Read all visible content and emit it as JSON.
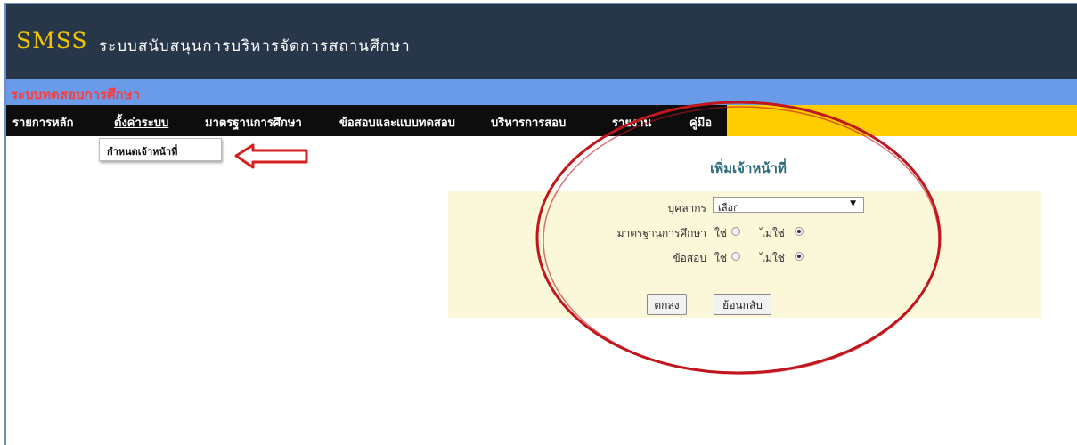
{
  "header": {
    "logo": "SMSS",
    "subtitle": "ระบบสนับสนุนการบริหารจัดการสถานศึกษา",
    "system_name": "ระบบทดสอบการศึกษา"
  },
  "menu": {
    "items": [
      {
        "label": "รายการหลัก"
      },
      {
        "label": "ตั้งค่าระบบ",
        "active": true
      },
      {
        "label": "มาตรฐานการศึกษา"
      },
      {
        "label": "ข้อสอบและแบบทดสอบ"
      },
      {
        "label": "บริหารการสอบ"
      },
      {
        "label": "รายงาน"
      },
      {
        "label": "คู่มือ"
      }
    ],
    "dropdown_item": "กำหนดเจ้าหน้าที่"
  },
  "form": {
    "title": "เพิ่มเจ้าหน้าที่",
    "personnel_label": "บุคลากร",
    "personnel_select": "เลือก",
    "standard_label": "มาตรฐานการศึกษา",
    "exam_label": "ข้อสอบ",
    "yes_label": "ใช่",
    "no_label": "ไม่ใช่",
    "standard_value": "no",
    "exam_value": "no",
    "ok_button": "ตกลง",
    "back_button": "ย้อนกลับ"
  },
  "annotation": {
    "arrow_color": "#d62020",
    "ellipse_color": "#c0161c"
  }
}
